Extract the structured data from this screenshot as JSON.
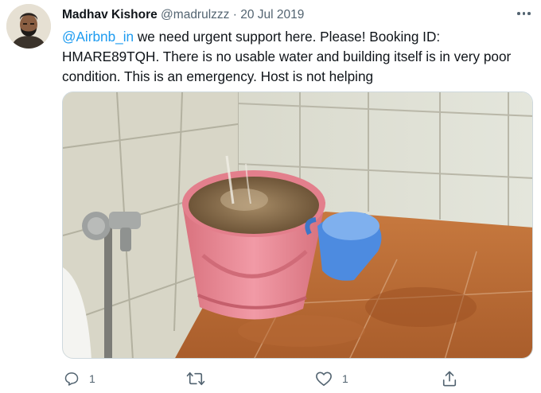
{
  "tweet": {
    "author_name": "Madhav Kishore",
    "author_handle": "@madrulzzz",
    "separator": "·",
    "date": "20 Jul 2019",
    "mention": "@Airbnb_in",
    "text": " we need urgent support here. Please! Booking ID: HMARE89TQH. There is no usable water and building itself is in very poor condition. This is an emergency.  Host is not helping"
  },
  "actions": {
    "reply_count": "1",
    "retweet_count": "",
    "like_count": "1"
  },
  "icons": {
    "more": "more-icon",
    "reply": "reply-icon",
    "retweet": "retweet-icon",
    "like": "heart-icon",
    "share": "share-icon"
  },
  "colors": {
    "link": "#1d9bf0",
    "secondary_text": "#536471",
    "primary_text": "#0f1419"
  }
}
